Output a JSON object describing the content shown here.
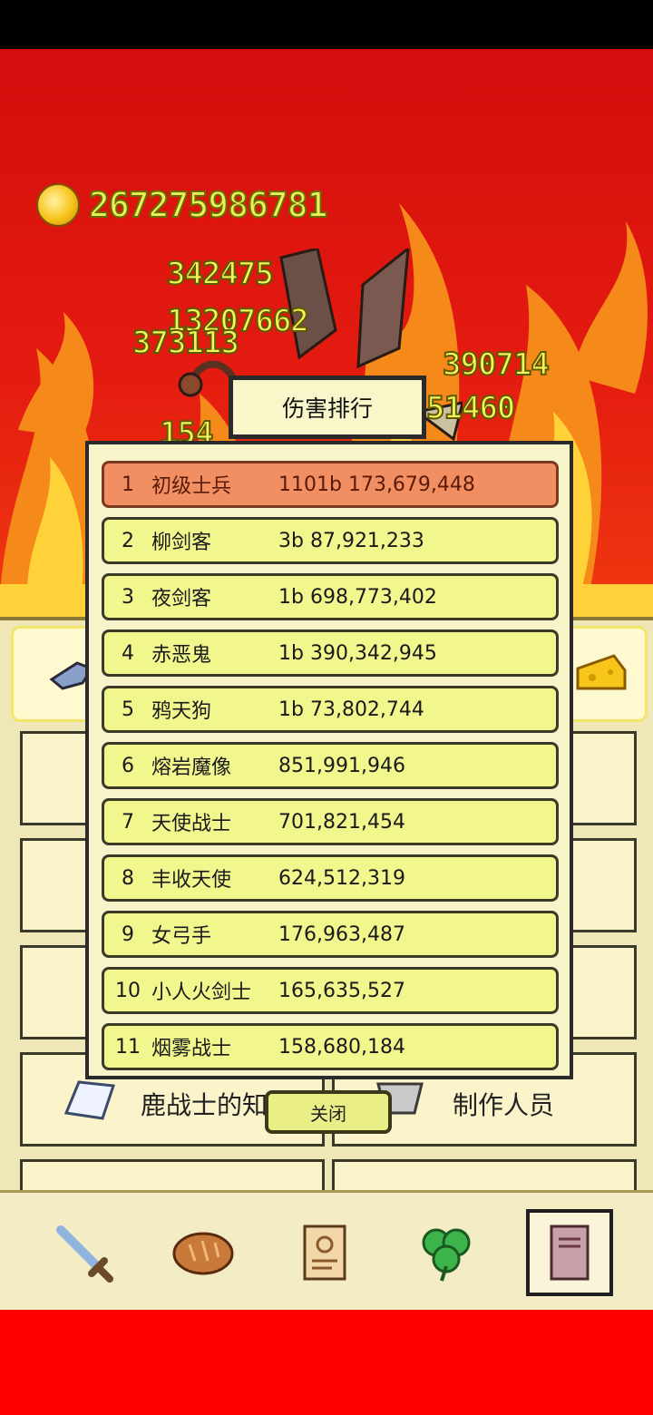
{
  "hud": {
    "coins": "267275986781"
  },
  "floating_damage": [
    "342475",
    "13207662",
    "373113",
    "390714",
    "51460",
    "154"
  ],
  "dialog": {
    "title": "伤害排行",
    "close_label": "关闭",
    "rows": [
      {
        "rank": "1",
        "name": "初级士兵",
        "score": "1101b 173,679,448",
        "highlight": true
      },
      {
        "rank": "2",
        "name": "柳剑客",
        "score": "3b 87,921,233"
      },
      {
        "rank": "3",
        "name": "夜剑客",
        "score": "1b 698,773,402"
      },
      {
        "rank": "4",
        "name": "赤恶鬼",
        "score": "1b 390,342,945"
      },
      {
        "rank": "5",
        "name": "鸦天狗",
        "score": "1b 73,802,744"
      },
      {
        "rank": "6",
        "name": "熔岩魔像",
        "score": "851,991,946"
      },
      {
        "rank": "7",
        "name": "天使战士",
        "score": "701,821,454"
      },
      {
        "rank": "8",
        "name": "丰收天使",
        "score": "624,512,319"
      },
      {
        "rank": "9",
        "name": "女弓手",
        "score": "176,963,487"
      },
      {
        "rank": "10",
        "name": "小人火剑士",
        "score": "165,635,527"
      },
      {
        "rank": "11",
        "name": "烟雾战士",
        "score": "158,680,184"
      }
    ]
  },
  "background_menu": {
    "left_item": "鹿战士的知识",
    "right_item": "制作人员"
  },
  "bottom_nav": [
    {
      "icon": "sword-icon"
    },
    {
      "icon": "bread-icon"
    },
    {
      "icon": "scroll-icon"
    },
    {
      "icon": "clover-icon"
    },
    {
      "icon": "book-icon",
      "active": true
    }
  ],
  "colors": {
    "sky_red": "#e41b10",
    "row_yellow": "#f1f78d",
    "row_highlight": "#f28f62",
    "damage_text": "#f4f55b"
  }
}
